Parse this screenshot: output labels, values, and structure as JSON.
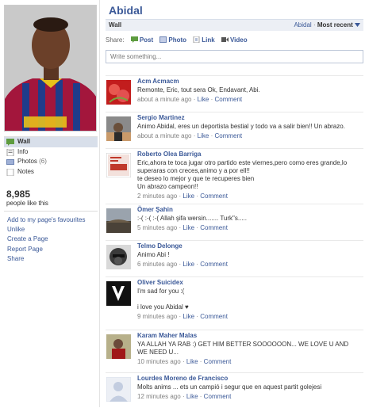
{
  "profile": {
    "name": "Abidal"
  },
  "nav": [
    {
      "label": "Wall",
      "icon": "wall-icon",
      "active": true
    },
    {
      "label": "Info",
      "icon": "info-icon"
    },
    {
      "label": "Photos",
      "count": "(6)",
      "icon": "photos-icon"
    },
    {
      "label": "Notes",
      "icon": "notes-icon"
    }
  ],
  "likes": {
    "count": "8,985",
    "label": "people like this"
  },
  "actions": [
    "Add to my page's favourites",
    "Unlike",
    "Create a Page",
    "Report Page",
    "Share"
  ],
  "wallbar": {
    "title": "Wall",
    "filter": "Abidal",
    "separator": "·",
    "sort": "Most recent"
  },
  "share": {
    "label": "Share:",
    "items": [
      "Post",
      "Photo",
      "Link",
      "Video"
    ]
  },
  "status": {
    "placeholder": "Write something..."
  },
  "meta_sep": "·",
  "meta_like": "Like",
  "meta_comment": "Comment",
  "stories": [
    {
      "author": "Acm Acmacm",
      "message": "Remonte, Eric, tout sera Ok, Endavant, Abi.",
      "time": "about a minute ago"
    },
    {
      "author": "Sergio Martinez",
      "message": "Animo Abidal, eres un deportista bestial y todo va a salir bien!! Un abrazo.",
      "time": "about a minute ago"
    },
    {
      "author": "Roberto Olea Barriga",
      "message": "Eric,ahora te toca jugar otro partido este viernes,pero como eres grande,lo\nsuperaras con creces,animo y a por ell!!\nte deseo lo mejor y que te recuperes bien\nUn abrazo campeon!!",
      "time": "2 minutes ago"
    },
    {
      "author": "Ömer Şahin",
      "message": ":-( :-( :-( Allah şifa wersin....... Turk\"s.....",
      "time": "5 minutes ago"
    },
    {
      "author": "Telmo Delonge",
      "message": "Animo Abi !",
      "time": "6 minutes ago"
    },
    {
      "author": "Oliver Suicidex",
      "message": "I'm sad for you :(\n\ni love you Abidal ♥",
      "time": "9 minutes ago"
    },
    {
      "author": "Karam Maher Malas",
      "message": "YA ALLAH YA RAB :) GET HIM BETTER SOOOOOON... WE LOVE U AND\nWE NEED U...",
      "time": "10 minutes ago"
    },
    {
      "author": "Lourdes Moreno de Francisco",
      "message": "Molts anims ... ets un campió i segur que en aquest partit golejesi",
      "time": "12 minutes ago"
    }
  ]
}
